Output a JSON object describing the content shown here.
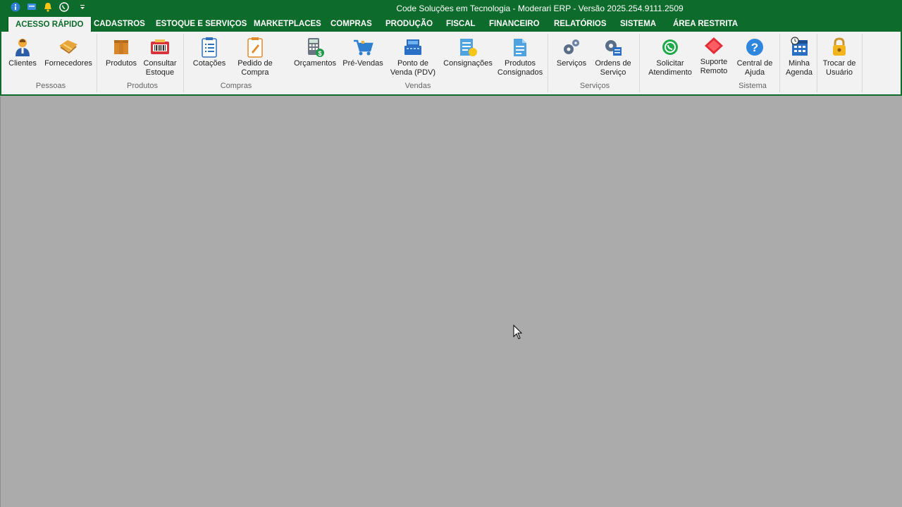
{
  "window": {
    "title": "Code Soluções em Tecnologia - Moderari ERP - Versão 2025.254.9111.2509"
  },
  "quick_access": [
    "info-icon",
    "chat-icon",
    "bell-icon",
    "whatsapp-icon",
    "customize-icon"
  ],
  "tabs": [
    {
      "label": "ACESSO RÁPIDO",
      "active": true
    },
    {
      "label": "CADASTROS"
    },
    {
      "label": "ESTOQUE E SERVIÇOS"
    },
    {
      "label": "MARKETPLACES"
    },
    {
      "label": "COMPRAS"
    },
    {
      "label": "PRODUÇÃO"
    },
    {
      "label": "FISCAL"
    },
    {
      "label": "FINANCEIRO"
    },
    {
      "label": "RELATÓRIOS"
    },
    {
      "label": "SISTEMA"
    },
    {
      "label": "ÁREA RESTRITA"
    }
  ],
  "groups": {
    "pessoas": {
      "label": "Pessoas",
      "buttons": {
        "clientes": "Clientes",
        "fornecedores": "Fornecedores"
      }
    },
    "produtos": {
      "label": "Produtos",
      "buttons": {
        "produtos": "Produtos",
        "consultar_estoque": "Consultar\nEstoque"
      }
    },
    "compras": {
      "label": "Compras",
      "buttons": {
        "cotacoes": "Cotações",
        "pedido_compra": "Pedido de\nCompra"
      }
    },
    "vendas": {
      "label": "Vendas",
      "buttons": {
        "orcamentos": "Orçamentos",
        "pre_vendas": "Pré-Vendas",
        "pdv": "Ponto de\nVenda (PDV)",
        "consignacoes": "Consignações",
        "produtos_consignados": "Produtos\nConsignados"
      }
    },
    "servicos": {
      "label": "Serviços",
      "buttons": {
        "servicos": "Serviços",
        "ordens_servico": "Ordens de\nServiço"
      }
    },
    "sistema": {
      "label": "Sistema",
      "buttons": {
        "solicitar": "Solicitar\nAtendimento",
        "suporte": "Suporte\nRemoto",
        "central": "Central de\nAjuda",
        "agenda": "Minha\nAgenda",
        "trocar": "Trocar de\nUsuário"
      }
    }
  },
  "colors": {
    "brand": "#0d6b2b",
    "ribbon_bg": "#f2f2f2",
    "workspace": "#ababab"
  }
}
